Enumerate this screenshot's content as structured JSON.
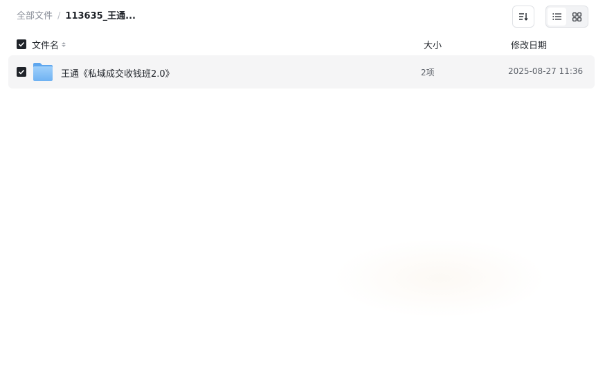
{
  "breadcrumb": {
    "root": "全部文件",
    "separator": "/",
    "current": "113635_王通..."
  },
  "toolbar": {
    "sort_icon": "sort-icon",
    "view_modes": [
      "list-view-icon",
      "grid-view-icon"
    ],
    "active_view": "list"
  },
  "columns": {
    "name": "文件名",
    "size": "大小",
    "date": "修改日期"
  },
  "files": [
    {
      "name": "王通《私域成交收钱班2.0》",
      "size": "2项",
      "date": "2025-08-27 11:36",
      "type": "folder",
      "checked": true
    }
  ],
  "colors": {
    "checkbox": "#1f2329",
    "row_bg": "#f5f5f6",
    "folder": "#7cbcf5"
  }
}
